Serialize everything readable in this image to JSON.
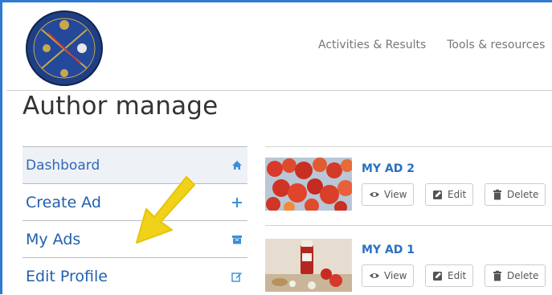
{
  "header": {
    "nav": [
      "Activities & Results",
      "Tools & resources"
    ]
  },
  "page": {
    "title": "Author manage"
  },
  "sidebar": {
    "items": [
      {
        "label": "Dashboard",
        "icon": "home-icon"
      },
      {
        "label": "Create Ad",
        "icon": "plus-icon"
      },
      {
        "label": "My Ads",
        "icon": "archive-icon"
      },
      {
        "label": "Edit Profile",
        "icon": "edit-icon"
      }
    ]
  },
  "ads": [
    {
      "title": "MY AD 2",
      "view": "View",
      "edit": "Edit",
      "delete": "Delete"
    },
    {
      "title": "MY AD 1",
      "view": "View",
      "edit": "Edit",
      "delete": "Delete"
    }
  ],
  "colors": {
    "accent": "#2160ad",
    "link": "#2a6fc1",
    "highlight_arrow": "#f1d21b"
  }
}
